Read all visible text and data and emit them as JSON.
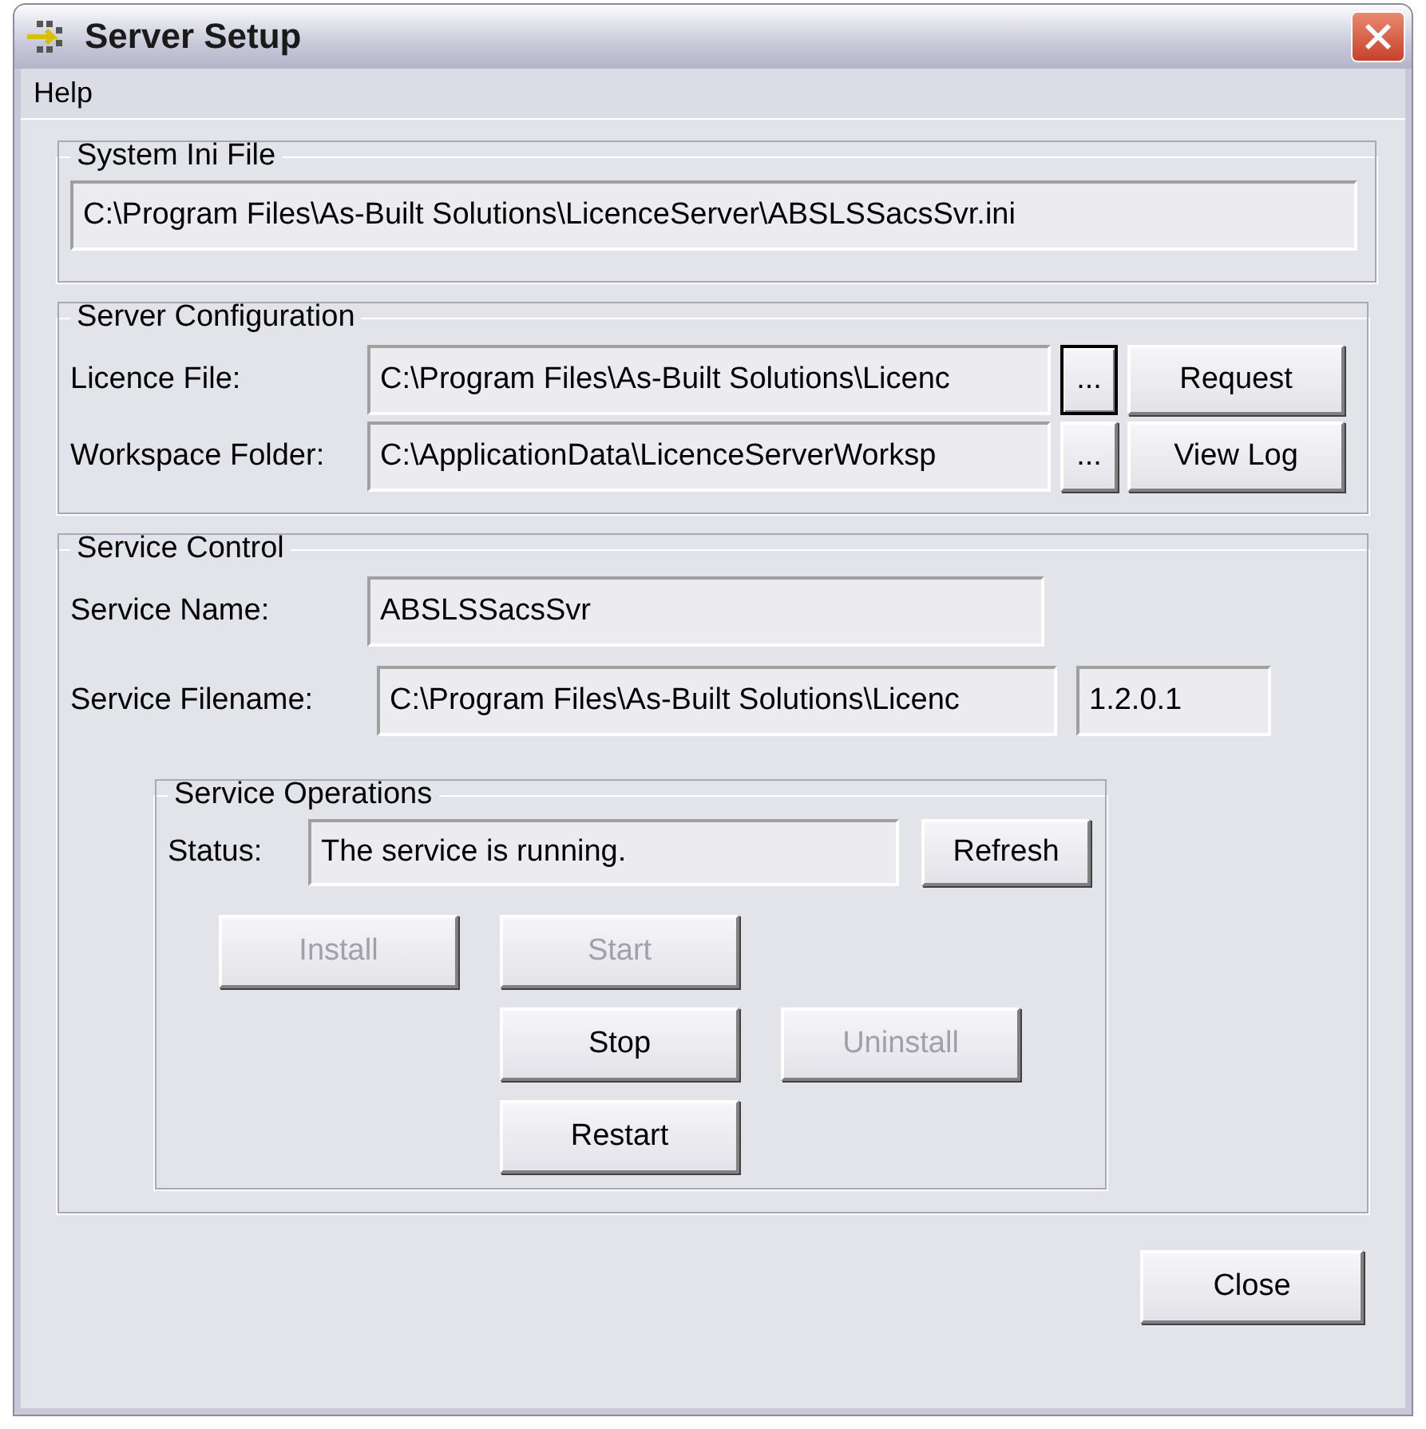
{
  "window": {
    "title": "Server Setup"
  },
  "menu": [
    {
      "label": "Help"
    }
  ],
  "system_ini": {
    "title": "System Ini File",
    "value": "C:\\Program Files\\As-Built Solutions\\LicenceServer\\ABSLSSacsSvr.ini"
  },
  "server_configuration": {
    "title": "Server Configuration",
    "rows": [
      {
        "label": "Licence File:",
        "value": "C:\\Program Files\\As-Built Solutions\\Licenc",
        "browse": {
          "label": "...",
          "focused": true
        },
        "action": "Request"
      },
      {
        "label": "Workspace Folder:",
        "value": "C:\\ApplicationData\\LicenceServerWorksp",
        "browse": {
          "label": "...",
          "focused": false
        },
        "action": "View Log"
      }
    ]
  },
  "service_control": {
    "title": "Service Control",
    "service_name": {
      "label": "Service Name:",
      "value": "ABSLSSacsSvr"
    },
    "service_filename": {
      "label": "Service Filename:",
      "value": "C:\\Program Files\\As-Built Solutions\\Licenc",
      "version": "1.2.0.1"
    },
    "operations": {
      "title": "Service Operations",
      "status_label": "Status:",
      "status": "The service is running.",
      "refresh": "Refresh",
      "buttons": [
        {
          "label": "Install",
          "disabled": true
        },
        {
          "label": "Start",
          "disabled": true
        },
        {
          "label": "Stop",
          "disabled": false
        },
        {
          "label": "Uninstall",
          "disabled": true
        },
        {
          "label": "Restart",
          "disabled": false
        }
      ]
    }
  },
  "close_button": "Close"
}
